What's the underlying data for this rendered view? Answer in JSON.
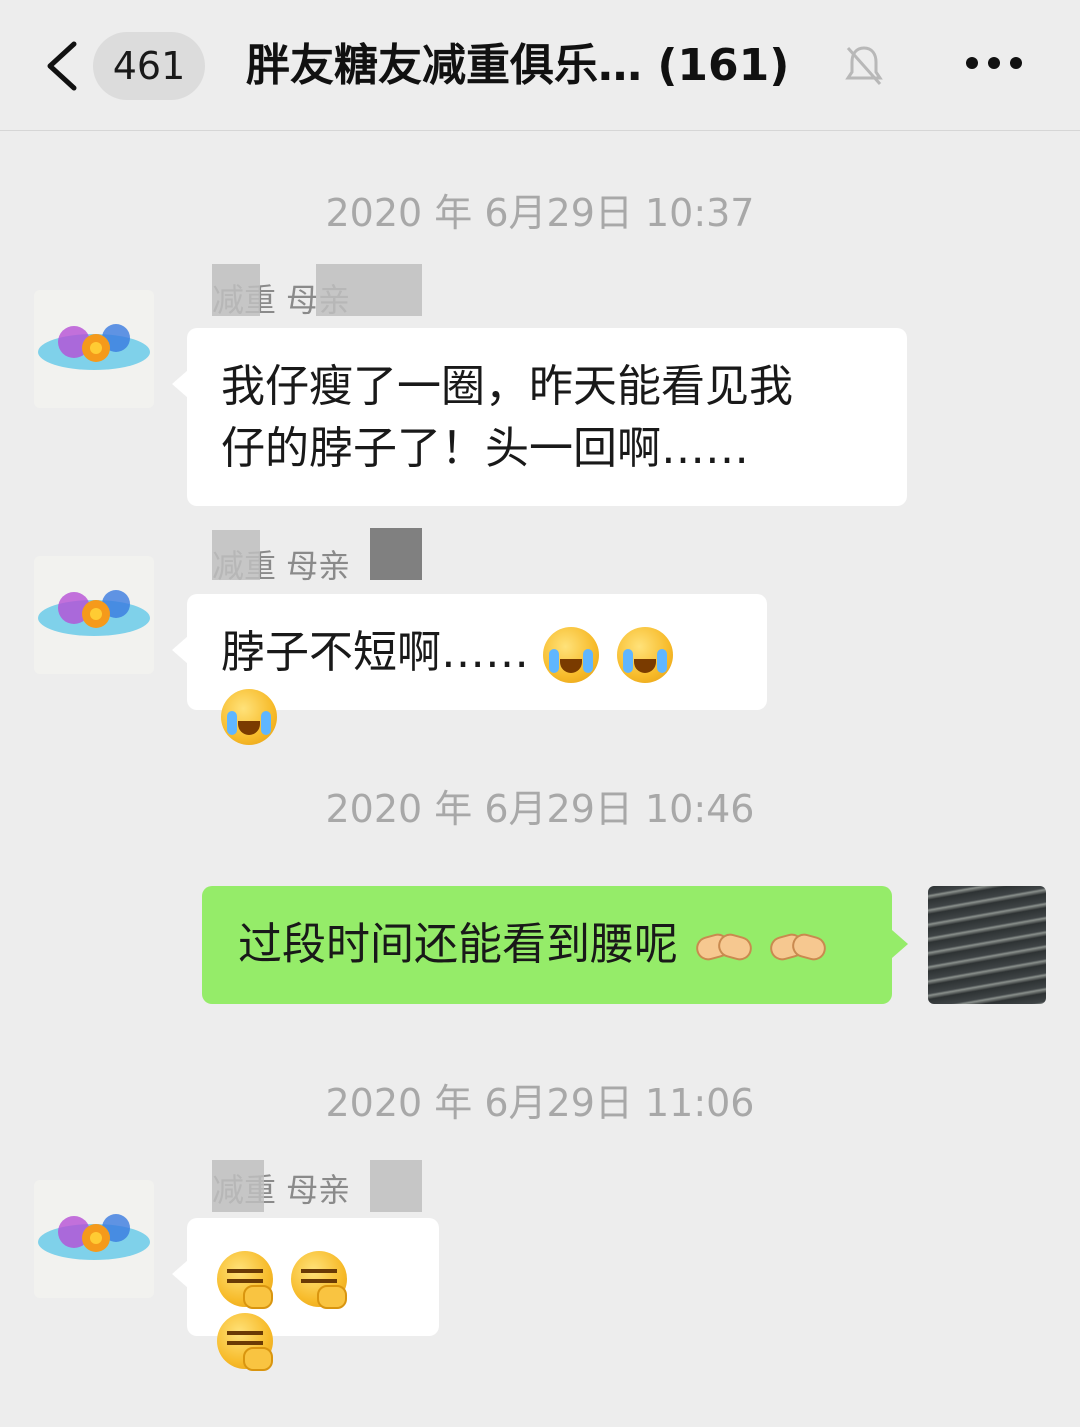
{
  "header": {
    "back_icon": "chevron-left-icon",
    "unread_count": "461",
    "title": "胖友糖友减重俱乐…  (161)",
    "mute_icon": "bell-muted-icon",
    "more_icon": "more-dots-icon"
  },
  "messages": [
    {
      "type": "time",
      "text": "2020 年 6月29日 10:37"
    },
    {
      "type": "in",
      "sender": "减重                    母亲",
      "text_line1": "我仔瘦了一圈，昨天能看见我",
      "text_line2": "仔的脖子了！头一回啊……"
    },
    {
      "type": "in",
      "sender": "减重                    母亲",
      "text": "脖子不短啊……",
      "emoji": "face-with-tears-of-joy"
    },
    {
      "type": "time",
      "text": "2020 年 6月29日 10:46"
    },
    {
      "type": "out",
      "text": "过段时间还能看到腰呢",
      "emoji": "handshake"
    },
    {
      "type": "time",
      "text": "2020 年 6月29日 11:06"
    },
    {
      "type": "in",
      "sender": "减重                    母亲",
      "emoji": "smirk-ok-hand"
    }
  ],
  "colors": {
    "background": "#ededed",
    "bubble_in": "#ffffff",
    "bubble_out": "#95ec69",
    "timestamp": "#a8a8a8"
  }
}
